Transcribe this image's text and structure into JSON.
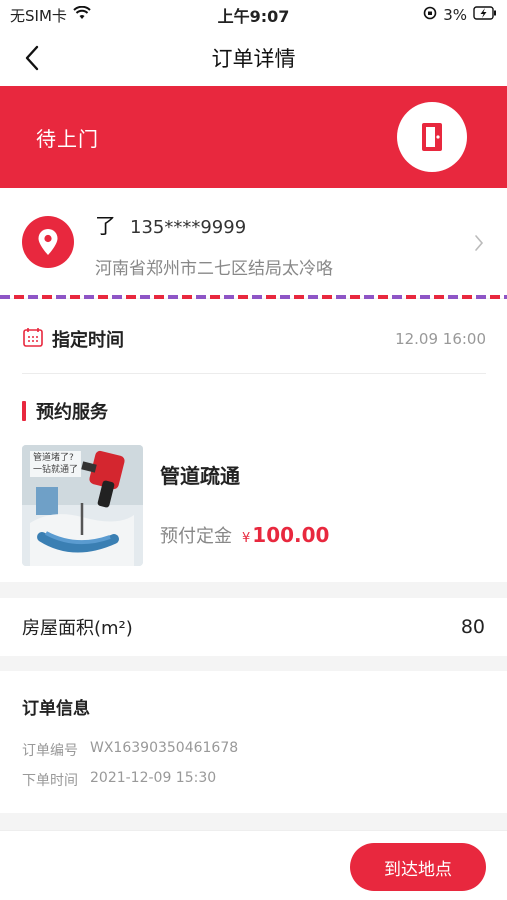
{
  "status_bar": {
    "carrier": "无SIM卡",
    "time": "上午9:07",
    "battery": "3%"
  },
  "nav": {
    "title": "订单详情"
  },
  "banner": {
    "status": "待上门",
    "icon": "door-icon"
  },
  "address": {
    "name": "了",
    "phone": "135****9999",
    "detail": "河南省郑州市二七区结局太冷咯"
  },
  "schedule": {
    "label": "指定时间",
    "value": "12.09 16:00"
  },
  "service": {
    "section_title": "预约服务",
    "image_caption_line1": "管道堵了?",
    "image_caption_line2": "一钻就通了",
    "name": "管道疏通",
    "deposit_label": "预付定金",
    "currency": "¥",
    "price": "100.00"
  },
  "area": {
    "label": "房屋面积(m²)",
    "value": "80"
  },
  "order_info": {
    "title": "订单信息",
    "number_label": "订单编号",
    "number": "WX16390350461678",
    "time_label": "下单时间",
    "time": "2021-12-09 15:30"
  },
  "actions": {
    "arrive_label": "到达地点"
  },
  "colors": {
    "accent": "#e8283e",
    "dashed_purple": "#8e55c6"
  }
}
